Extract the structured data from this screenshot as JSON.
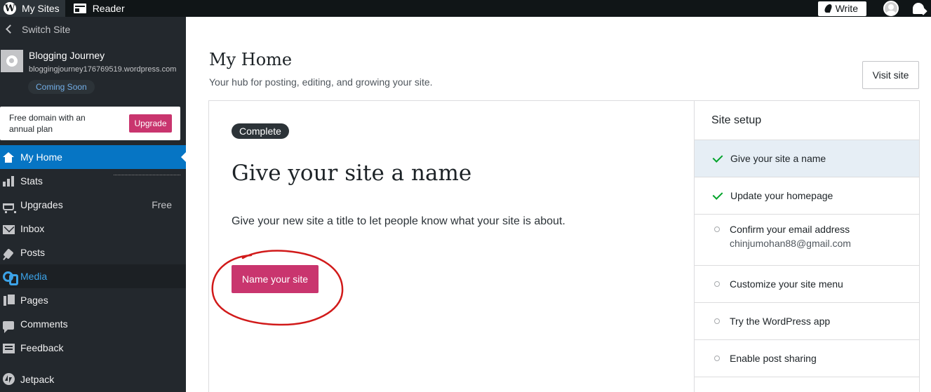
{
  "topbar": {
    "my_sites": "My Sites",
    "reader": "Reader",
    "write": "Write"
  },
  "sidebar": {
    "switch_site": "Switch Site",
    "site_name": "Blogging Journey",
    "site_url": "bloggingjourney176769519.wordpress.com",
    "status_badge": "Coming Soon",
    "upgrade_card": {
      "text": "Free domain with an annual plan",
      "button": "Upgrade"
    },
    "items": [
      {
        "label": "My Home",
        "icon": "home-icon"
      },
      {
        "label": "Stats",
        "icon": "stats-icon"
      },
      {
        "label": "Upgrades",
        "icon": "cart-icon",
        "badge": "Free"
      },
      {
        "label": "Inbox",
        "icon": "inbox-icon"
      },
      {
        "label": "Posts",
        "icon": "pin-icon"
      },
      {
        "label": "Media",
        "icon": "media-icon"
      },
      {
        "label": "Pages",
        "icon": "pages-icon"
      },
      {
        "label": "Comments",
        "icon": "comment-icon"
      },
      {
        "label": "Feedback",
        "icon": "feedback-icon"
      },
      {
        "label": "Jetpack",
        "icon": "jetpack-icon"
      }
    ]
  },
  "main": {
    "title": "My Home",
    "subtitle": "Your hub for posting, editing, and growing your site.",
    "visit_site": "Visit site",
    "task": {
      "badge": "Complete",
      "title": "Give your site a name",
      "description": "Give your new site a title to let people know what your site is about.",
      "button": "Name your site"
    },
    "setup": {
      "title": "Site setup",
      "items": [
        {
          "label": "Give your site a name",
          "done": true
        },
        {
          "label": "Update your homepage",
          "done": true
        },
        {
          "label": "Confirm your email address",
          "sub": "chinjumohan88@gmail.com",
          "done": false
        },
        {
          "label": "Customize your site menu",
          "done": false
        },
        {
          "label": "Try the WordPress app",
          "done": false
        },
        {
          "label": "Enable post sharing",
          "done": false
        }
      ]
    }
  },
  "colors": {
    "accent_pink": "#c9356e",
    "active_blue": "#0675c4",
    "sidebar_bg": "#23282d",
    "annotation_red": "#d11a1a",
    "check_green": "#00a32a"
  }
}
